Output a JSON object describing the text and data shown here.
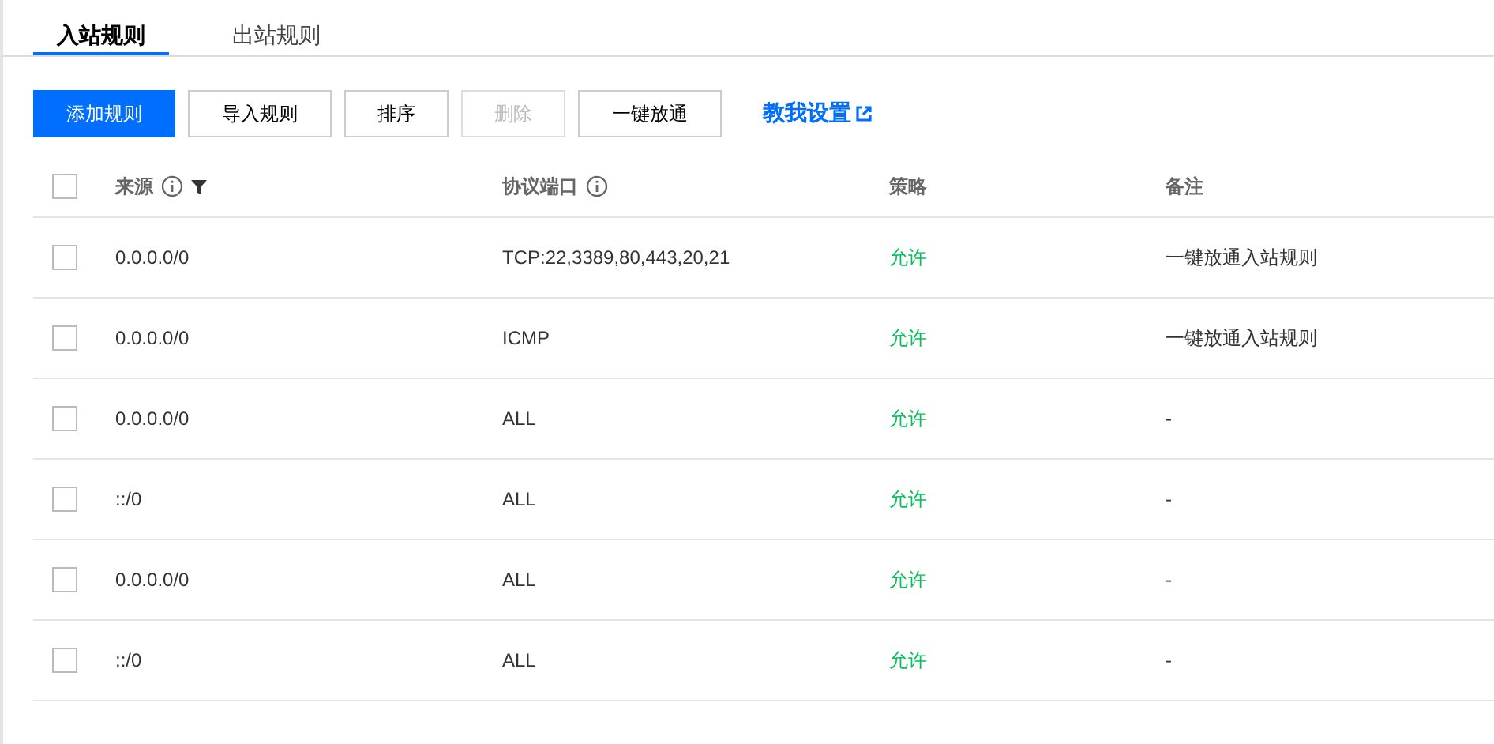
{
  "tabs": [
    {
      "label": "入站规则",
      "selected": true
    },
    {
      "label": "出站规则",
      "selected": false
    }
  ],
  "toolbar": {
    "buttons": [
      {
        "label": "添加规则",
        "kind": "primary",
        "disabled": false
      },
      {
        "label": "导入规则",
        "kind": "default",
        "disabled": false
      },
      {
        "label": "排序",
        "kind": "default",
        "disabled": false
      },
      {
        "label": "删除",
        "kind": "default",
        "disabled": true
      },
      {
        "label": "一键放通",
        "kind": "default",
        "disabled": false
      }
    ],
    "help_link": "教我设置"
  },
  "table": {
    "all_checked": false,
    "columns": [
      {
        "label": "来源",
        "info": true,
        "filter": true
      },
      {
        "label": "协议端口",
        "info": true,
        "filter": false
      },
      {
        "label": "策略",
        "info": false,
        "filter": false
      },
      {
        "label": "备注",
        "info": false,
        "filter": false
      }
    ],
    "rows": [
      {
        "checked": false,
        "source": "0.0.0.0/0",
        "port": "TCP:22,3389,80,443,20,21",
        "policy": "允许",
        "color": "#0abf5b",
        "remark": "一键放通入站规则"
      },
      {
        "checked": false,
        "source": "0.0.0.0/0",
        "port": "ICMP",
        "policy": "允许",
        "color": "#0abf5b",
        "remark": "一键放通入站规则"
      },
      {
        "checked": false,
        "source": "0.0.0.0/0",
        "port": "ALL",
        "policy": "允许",
        "color": "#0abf5b",
        "remark": "-"
      },
      {
        "checked": false,
        "source": "::/0",
        "port": "ALL",
        "policy": "允许",
        "color": "#0abf5b",
        "remark": "-"
      },
      {
        "checked": false,
        "source": "0.0.0.0/0",
        "port": "ALL",
        "policy": "允许",
        "color": "#0abf5b",
        "remark": "-"
      },
      {
        "checked": false,
        "source": "::/0",
        "port": "ALL",
        "policy": "允许",
        "color": "#0abf5b",
        "remark": "-"
      }
    ]
  }
}
